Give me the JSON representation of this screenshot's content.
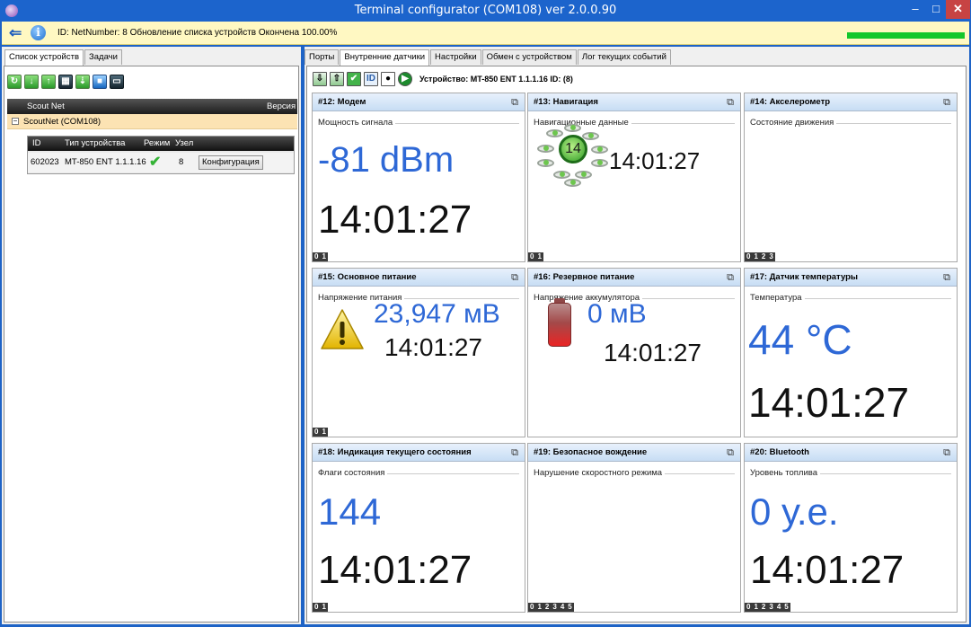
{
  "window": {
    "title": "Terminal configurator (COM108) ver 2.0.0.90",
    "min_glyph": "–",
    "max_glyph": "□",
    "close_glyph": "✕"
  },
  "infobar": {
    "status": "ID:  NetNumber: 8 Обновление списка устройств Окончена 100.00%",
    "progress": 1.0
  },
  "left": {
    "tabs": [
      "Список устройств",
      "Задачи"
    ],
    "toolbar_icons": [
      "refresh-icon",
      "download-icon",
      "upload-icon",
      "grid-icon",
      "grid-download-icon",
      "lock-icon",
      "monitor-icon"
    ],
    "tree": {
      "col_name": "Scout Net",
      "col_version": "Версия",
      "node": "ScoutNet (COM108)",
      "expander": "−"
    },
    "devices": {
      "headers": {
        "id": "ID",
        "type": "Тип устройства",
        "mode": "Режим",
        "node": "Узел"
      },
      "row": {
        "id": "602023",
        "type": "MT-850 ENT 1.1.1.16",
        "node": "8",
        "config": "Конфигурация"
      }
    }
  },
  "right": {
    "tabs": [
      "Порты",
      "Внутренние датчики",
      "Настройки",
      "Обмен с устройством",
      "Лог текущих событий"
    ],
    "device_caption": "Устройство: MT-850 ENT 1.1.1.16 ID:  (8)",
    "id_label": "ID",
    "panels": {
      "p12": {
        "title": "#12: Модем",
        "label": "Мощность сигнала",
        "value": "-81 dBm",
        "time": "14:01:27",
        "pages": [
          "0",
          "1"
        ]
      },
      "p13": {
        "title": "#13: Навигация",
        "label": "Навигационные данные",
        "satellites": "14",
        "time": "14:01:27",
        "pages": [
          "0",
          "1"
        ]
      },
      "p14": {
        "title": "#14: Акселерометр",
        "label": "Состояние движения",
        "pages": [
          "0",
          "1",
          "2",
          "3"
        ]
      },
      "p15": {
        "title": "#15: Основное питание",
        "label": "Напряжение питания",
        "value": "23,947 мВ",
        "time": "14:01:27",
        "pages": [
          "0",
          "1"
        ]
      },
      "p16": {
        "title": "#16: Резервное питание",
        "label": "Напряжение аккумулятора",
        "value": "0 мВ",
        "time": "14:01:27"
      },
      "p17": {
        "title": "#17: Датчик температуры",
        "label": "Температура",
        "value": "44 °C",
        "time": "14:01:27"
      },
      "p18": {
        "title": "#18: Индикация текущего состояния",
        "label": "Флаги состояния",
        "value": "144",
        "time": "14:01:27",
        "pages": [
          "0",
          "1"
        ]
      },
      "p19": {
        "title": "#19: Безопасное вождение",
        "label": "Нарушение скоростного режима",
        "pages": [
          "0",
          "1",
          "2",
          "3",
          "4",
          "5"
        ]
      },
      "p20": {
        "title": "#20: Bluetooth",
        "label": "Уровень топлива",
        "value": "0 у.е.",
        "time": "14:01:27",
        "pages": [
          "0",
          "1",
          "2",
          "3",
          "4",
          "5"
        ]
      }
    }
  },
  "colors": {
    "titlebar": "#1c64cc",
    "infobar": "#fff8c2",
    "progress": "#13c72c",
    "value_blue": "#2e68d6",
    "tree_selected": "#fce3b3"
  }
}
